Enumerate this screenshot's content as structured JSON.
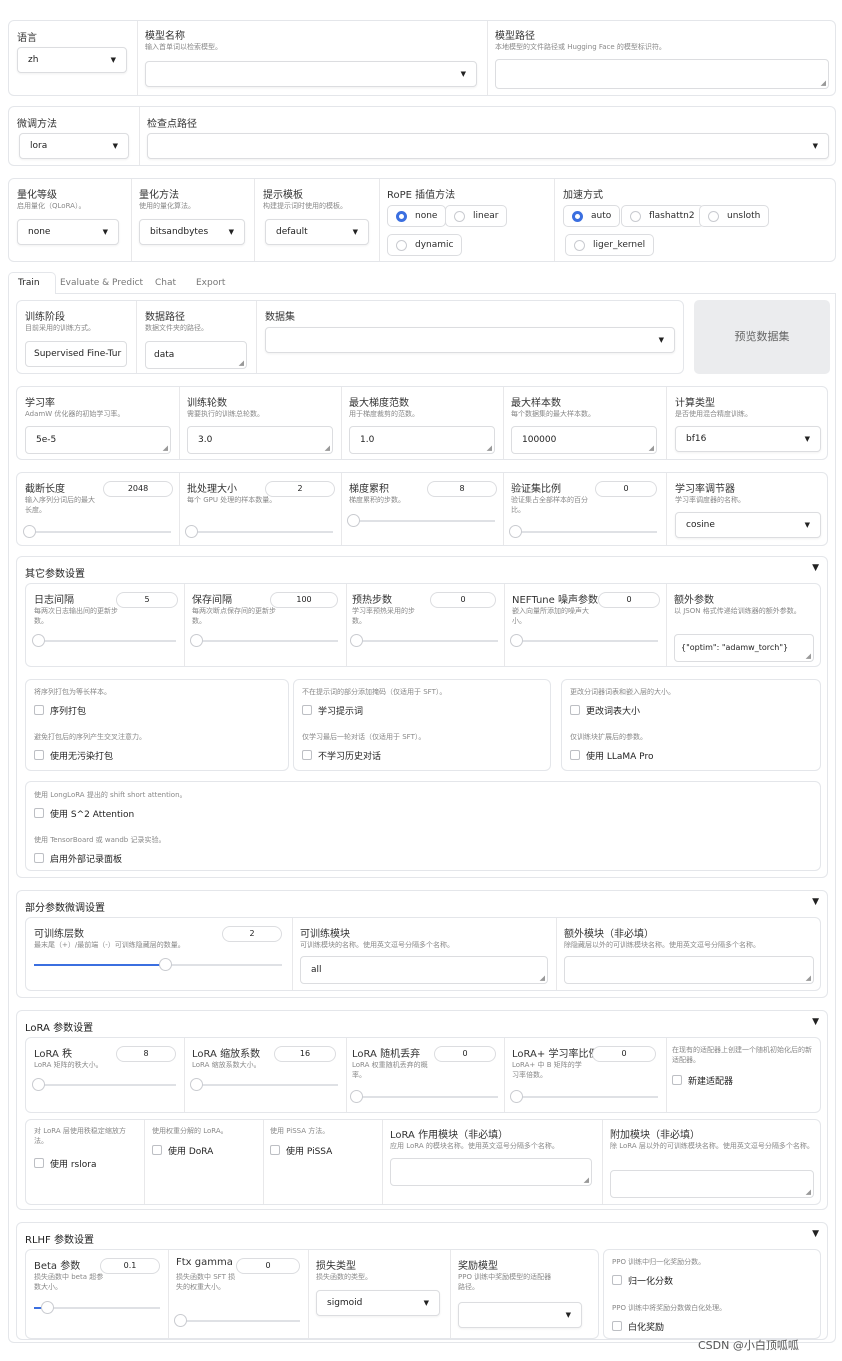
{
  "top": {
    "language": {
      "label": "语言",
      "value": "zh"
    },
    "model_name": {
      "label": "模型名称",
      "info": "输入首单词以检索模型。",
      "value": ""
    },
    "model_path": {
      "label": "模型路径",
      "info": "本地模型的文件路径或 Hugging Face 的模型标识符。",
      "value": ""
    }
  },
  "finetune": {
    "method_label": "微调方法",
    "method_value": "lora",
    "ckpt_label": "检查点路径",
    "ckpt_value": ""
  },
  "quant": {
    "bit_label": "量化等级",
    "bit_info": "启用量化（QLoRA）。",
    "bit_value": "none",
    "method_label": "量化方法",
    "method_info": "使用的量化算法。",
    "method_value": "bitsandbytes",
    "template_label": "提示模板",
    "template_info": "构建提示词时使用的模板。",
    "template_value": "default",
    "rope_label": "RoPE 插值方法",
    "rope_options": [
      "none",
      "linear",
      "dynamic"
    ],
    "rope_selected": "none",
    "accel_label": "加速方式",
    "accel_options": [
      "auto",
      "flashattn2",
      "unsloth",
      "liger_kernel"
    ],
    "accel_selected": "auto"
  },
  "tabs": [
    "Train",
    "Evaluate & Predict",
    "Chat",
    "Export"
  ],
  "train": {
    "stage_label": "训练阶段",
    "stage_info": "目前采用的训练方式。",
    "stage_value": "Supervised Fine-Tur",
    "dir_label": "数据路径",
    "dir_info": "数据文件夹的路径。",
    "dir_value": "data",
    "dataset_label": "数据集",
    "dataset_value": "",
    "preview_button": "预览数据集",
    "lr_label": "学习率",
    "lr_info": "AdamW 优化器的初始学习率。",
    "lr_value": "5e-5",
    "epochs_label": "训练轮数",
    "epochs_info": "需要执行的训练总轮数。",
    "epochs_value": "3.0",
    "maxnorm_label": "最大梯度范数",
    "maxnorm_info": "用于梯度裁剪的范数。",
    "maxnorm_value": "1.0",
    "maxsamples_label": "最大样本数",
    "maxsamples_info": "每个数据集的最大样本数。",
    "maxsamples_value": "100000",
    "compute_label": "计算类型",
    "compute_info": "是否使用混合精度训练。",
    "compute_value": "bf16",
    "cutoff_label": "截断长度",
    "cutoff_info": "输入序列分词后的最大长度。",
    "cutoff_value": 2048,
    "cutoff_fraction": 0.01,
    "batch_label": "批处理大小",
    "batch_info": "每个 GPU 处理的样本数量。",
    "batch_value": 2,
    "batch_fraction": 0.0,
    "grad_label": "梯度累积",
    "grad_info": "梯度累积的步数。",
    "grad_value": 8,
    "grad_fraction": 0.0,
    "val_label": "验证集比例",
    "val_info": "验证集占全部样本的百分比。",
    "val_value": 0,
    "val_fraction": 0.0,
    "sched_label": "学习率调节器",
    "sched_info": "学习率调度器的名称。",
    "sched_value": "cosine"
  },
  "other": {
    "title": "其它参数设置",
    "log_label": "日志间隔",
    "log_info": "每两次日志输出间的更新步数。",
    "log_value": 5,
    "log_fraction": 0.0,
    "save_label": "保存间隔",
    "save_info": "每两次断点保存间的更新步数。",
    "save_value": 100,
    "save_fraction": 0.01,
    "warmup_label": "预热步数",
    "warmup_info": "学习率预热采用的步数。",
    "warmup_value": 0,
    "warmup_fraction": 0.0,
    "neft_label": "NEFTune 噪声参数",
    "neft_info": "嵌入向量所添加的噪声大小。",
    "neft_value": 0,
    "neft_fraction": 0.0,
    "extra_label": "额外参数",
    "extra_info": "以 JSON 格式传递给训练器的额外参数。",
    "extra_value": "{\"optim\": \"adamw_torch\"}",
    "packing_info": "将序列打包为等长样本。",
    "packing_label": "序列打包",
    "trainprompt_info": "不在提示词的部分添加掩码（仅适用于 SFT）。",
    "trainprompt_label": "学习提示词",
    "resize_info": "更改分词器词表和嵌入层的大小。",
    "resize_label": "更改词表大小",
    "neat_info": "避免打包后的序列产生交叉注意力。",
    "neat_label": "使用无污染打包",
    "lastturn_info": "仅学习最后一轮对话（仅适用于 SFT）。",
    "lastturn_label": "不学习历史对话",
    "llamapro_info": "仅训练块扩展后的参数。",
    "llamapro_label": "使用 LLaMA Pro",
    "s2_info": "使用 LongLoRA 提出的 shift short attention。",
    "s2_label": "使用 S^2 Attention",
    "report_info": "使用 TensorBoard 或 wandb 记录实验。",
    "report_label": "启用外部记录面板"
  },
  "freeze": {
    "title": "部分参数微调设置",
    "layers_label": "可训练层数",
    "layers_info": "最末尾（+）/最前端（-）可训练隐藏层的数量。",
    "layers_value": 2,
    "layers_fraction": 0.53,
    "modules_label": "可训练模块",
    "modules_info": "可训练模块的名称。使用英文逗号分隔多个名称。",
    "modules_value": "all",
    "extra_label": "额外模块（非必填）",
    "extra_info": "除隐藏层以外的可训练模块名称。使用英文逗号分隔多个名称。",
    "extra_value": ""
  },
  "lora": {
    "title": "LoRA 参数设置",
    "rank_label": "LoRA 秩",
    "rank_info": "LoRA 矩阵的秩大小。",
    "rank_value": 8,
    "rank_fraction": 0.0,
    "alpha_label": "LoRA 缩放系数",
    "alpha_info": "LoRA 缩放系数大小。",
    "alpha_value": 16,
    "alpha_fraction": 0.0,
    "dropout_label": "LoRA 随机丢弃",
    "dropout_info": "LoRA 权重随机丢弃的概率。",
    "dropout_value": 0,
    "dropout_fraction": 0.0,
    "plus_label": "LoRA+ 学习率比例",
    "plus_info": "LoRA+ 中 B 矩阵的学习率倍数。",
    "plus_value": 0,
    "plus_fraction": 0.0,
    "newadapter_info": "在现有的适配器上创建一个随机初始化后的新适配器。",
    "newadapter_label": "新建适配器",
    "rslora_info": "对 LoRA 层使用秩稳定缩放方法。",
    "rslora_label": "使用 rslora",
    "dora_info": "使用权重分解的 LoRA。",
    "dora_label": "使用 DoRA",
    "pissa_info": "使用 PiSSA 方法。",
    "pissa_label": "使用 PiSSA",
    "target_label": "LoRA 作用模块（非必填）",
    "target_info": "应用 LoRA 的模块名称。使用英文逗号分隔多个名称。",
    "target_value": "",
    "addl_label": "附加模块（非必填）",
    "addl_info": "除 LoRA 层以外的可训练模块名称。使用英文逗号分隔多个名称。",
    "addl_value": ""
  },
  "rlhf": {
    "title": "RLHF 参数设置",
    "beta_label": "Beta 参数",
    "beta_info": "损失函数中 beta 超参数大小。",
    "beta_value": 0.1,
    "beta_fraction": 0.1,
    "ftx_label": "Ftx gamma",
    "ftx_info": "损失函数中 SFT 损失的权重大小。",
    "ftx_value": 0,
    "ftx_fraction": 0.0,
    "loss_label": "损失类型",
    "loss_info": "损失函数的类型。",
    "loss_value": "sigmoid",
    "reward_label": "奖励模型",
    "reward_info": "PPO 训练中奖励模型的适配器路径。",
    "reward_value": "",
    "score_info": "PPO 训练中归一化奖励分数。",
    "score_label": "归一化分数",
    "whiten_info": "PPO 训练中将奖励分数做白化处理。",
    "whiten_label": "白化奖励"
  },
  "watermark": "CSDN @小白顶呱呱"
}
